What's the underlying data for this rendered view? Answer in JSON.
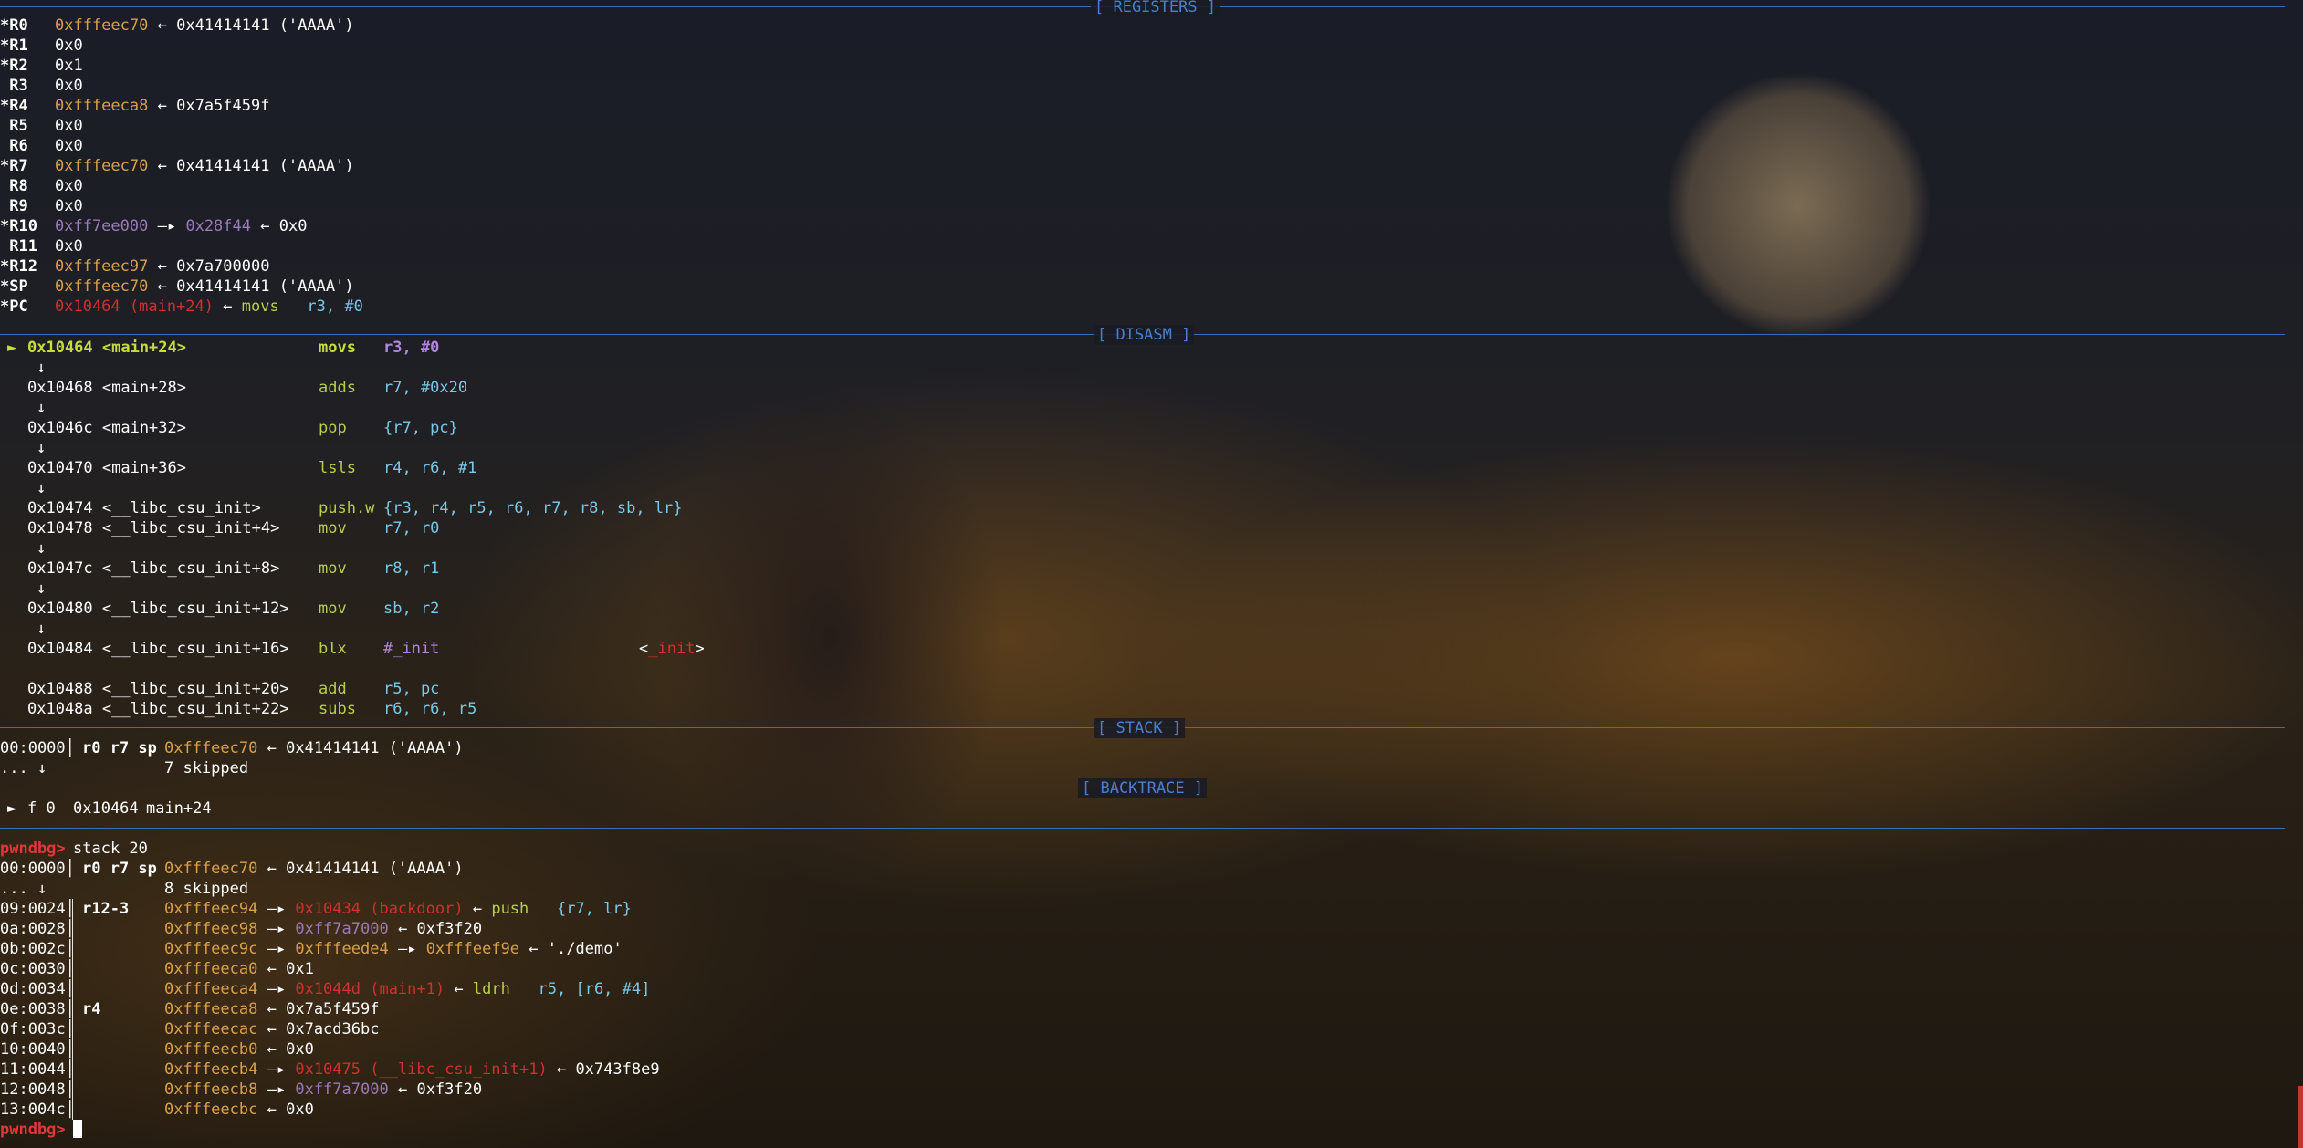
{
  "sections": {
    "registers": "[ REGISTERS ]",
    "disasm": "[ DISASM ]",
    "stack": "[ STACK ]",
    "backtrace": "[ BACKTRACE ]"
  },
  "registers": [
    {
      "name": "*R0",
      "addr": "0xfffeec70",
      "arrow": "←",
      "val": "0x41414141 ('AAAA')"
    },
    {
      "name": "*R1",
      "plain": "0x0"
    },
    {
      "name": "*R2",
      "plain": "0x1"
    },
    {
      "name": " R3",
      "plain": "0x0"
    },
    {
      "name": "*R4",
      "addr": "0xfffeeca8",
      "arrow": "←",
      "val": "0x7a5f459f"
    },
    {
      "name": " R5",
      "plain": "0x0"
    },
    {
      "name": " R6",
      "plain": "0x0"
    },
    {
      "name": "*R7",
      "addr": "0xfffeec70",
      "arrow": "←",
      "val": "0x41414141 ('AAAA')"
    },
    {
      "name": " R8",
      "plain": "0x0"
    },
    {
      "name": " R9",
      "plain": "0x0"
    },
    {
      "name": "*R10",
      "addr": "0xff7ee000",
      "arrow": "—▸",
      "mid": "0x28f44",
      "arrow2": "←",
      "val": "0x0"
    },
    {
      "name": " R11",
      "plain": "0x0"
    },
    {
      "name": "*R12",
      "addr": "0xfffeec97",
      "arrow": "←",
      "val": "0x7a700000"
    },
    {
      "name": "*SP",
      "addr": "0xfffeec70",
      "arrow": "←",
      "val": "0x41414141 ('AAAA')"
    },
    {
      "name": "*PC",
      "code": "0x10464 (main+24)",
      "arrow": "←",
      "op": "movs",
      "args": "r3, #0"
    }
  ],
  "disasm": [
    {
      "marker": "►",
      "addr": "0x10464 <main+24>",
      "op": "movs",
      "args": "r3, #0",
      "current": true
    },
    {
      "down": "↓"
    },
    {
      "addr": "0x10468 <main+28>",
      "op": "adds",
      "args": "r7, #0x20"
    },
    {
      "down": "↓"
    },
    {
      "addr": "0x1046c <main+32>",
      "op": "pop",
      "args": "{r7, pc}"
    },
    {
      "down": "↓"
    },
    {
      "addr": "0x10470 <main+36>",
      "op": "lsls",
      "args": "r4, r6, #1"
    },
    {
      "down": "↓"
    },
    {
      "addr": "0x10474 <__libc_csu_init>",
      "op": "push.w",
      "args": "{r3, r4, r5, r6, r7, r8, sb, lr}"
    },
    {
      "addr": "0x10478 <__libc_csu_init+4>",
      "op": "mov",
      "args": "r7, r0"
    },
    {
      "down": "↓"
    },
    {
      "addr": "0x1047c <__libc_csu_init+8>",
      "op": "mov",
      "args": "r8, r1"
    },
    {
      "down": "↓"
    },
    {
      "addr": "0x10480 <__libc_csu_init+12>",
      "op": "mov",
      "args": "sb, r2"
    },
    {
      "down": "↓"
    },
    {
      "addr": "0x10484 <__libc_csu_init+16>",
      "op": "blx",
      "args": "#_init",
      "target": "_init"
    },
    {
      "blank": ""
    },
    {
      "addr": "0x10488 <__libc_csu_init+20>",
      "op": "add",
      "args": "r5, pc"
    },
    {
      "addr": "0x1048a <__libc_csu_init+22>",
      "op": "subs",
      "args": "r6, r6, r5"
    }
  ],
  "stack_pane": [
    {
      "off": "00:0000│",
      "regs": "r0 r7 sp",
      "addr": "0xfffeec70",
      "arrow": "←",
      "val": "0x41414141 ('AAAA')"
    },
    {
      "off": "... ↓",
      "skip": "7 skipped"
    }
  ],
  "backtrace": {
    "marker": "►",
    "frame": "f 0",
    "addr": "0x10464",
    "sym": "main+24"
  },
  "prompt": "pwndbg>",
  "command": "stack 20",
  "stack_cmd": [
    {
      "off": "00:0000│",
      "regs": "r0 r7 sp",
      "addr": "0xfffeec70",
      "arrow": "←",
      "val": "0x41414141 ('AAAA')"
    },
    {
      "off": "... ↓",
      "skip": "8 skipped"
    },
    {
      "off": "09:0024│",
      "regs": "r12-3",
      "addr": "0xfffeec94",
      "arrow": "—▸",
      "code": "0x10434 (backdoor)",
      "arrow2": "←",
      "op": "push",
      "args": "{r7, lr}"
    },
    {
      "off": "0a:0028│",
      "addr": "0xfffeec98",
      "arrow": "—▸",
      "dat": "0xff7a7000",
      "arrow2": "←",
      "val": "0xf3f20"
    },
    {
      "off": "0b:002c│",
      "addr": "0xfffeec9c",
      "arrow": "—▸",
      "stk": "0xfffeede4",
      "arrow2": "—▸",
      "stk2": "0xfffeef9e",
      "arrow3": "←",
      "val": "'./demo'"
    },
    {
      "off": "0c:0030│",
      "addr": "0xfffeeca0",
      "arrow": "←",
      "val": "0x1"
    },
    {
      "off": "0d:0034│",
      "addr": "0xfffeeca4",
      "arrow": "—▸",
      "code": "0x1044d (main+1)",
      "arrow2": "←",
      "op": "ldrh",
      "args": "r5, [r6, #4]"
    },
    {
      "off": "0e:0038│",
      "regs": "r4",
      "addr": "0xfffeeca8",
      "arrow": "←",
      "val": "0x7a5f459f"
    },
    {
      "off": "0f:003c│",
      "addr": "0xfffeecac",
      "arrow": "←",
      "val": "0x7acd36bc"
    },
    {
      "off": "10:0040│",
      "addr": "0xfffeecb0",
      "arrow": "←",
      "val": "0x0"
    },
    {
      "off": "11:0044│",
      "addr": "0xfffeecb4",
      "arrow": "—▸",
      "code": "0x10475 (__libc_csu_init+1)",
      "arrow2": "←",
      "val": "0x743f8e9"
    },
    {
      "off": "12:0048│",
      "addr": "0xfffeecb8",
      "arrow": "—▸",
      "dat": "0xff7a7000",
      "arrow2": "←",
      "val": "0xf3f20"
    },
    {
      "off": "13:004c│",
      "addr": "0xfffeecbc",
      "arrow": "←",
      "val": "0x0"
    }
  ],
  "colors": {
    "address": "#d8a04a",
    "code": "#d03030",
    "data": "#9a7ab8",
    "opcode": "#b7cf4a",
    "register": "#78c8e8",
    "immediate": "#b085e0",
    "section": "#4a7fd0",
    "prompt": "#e03838"
  }
}
